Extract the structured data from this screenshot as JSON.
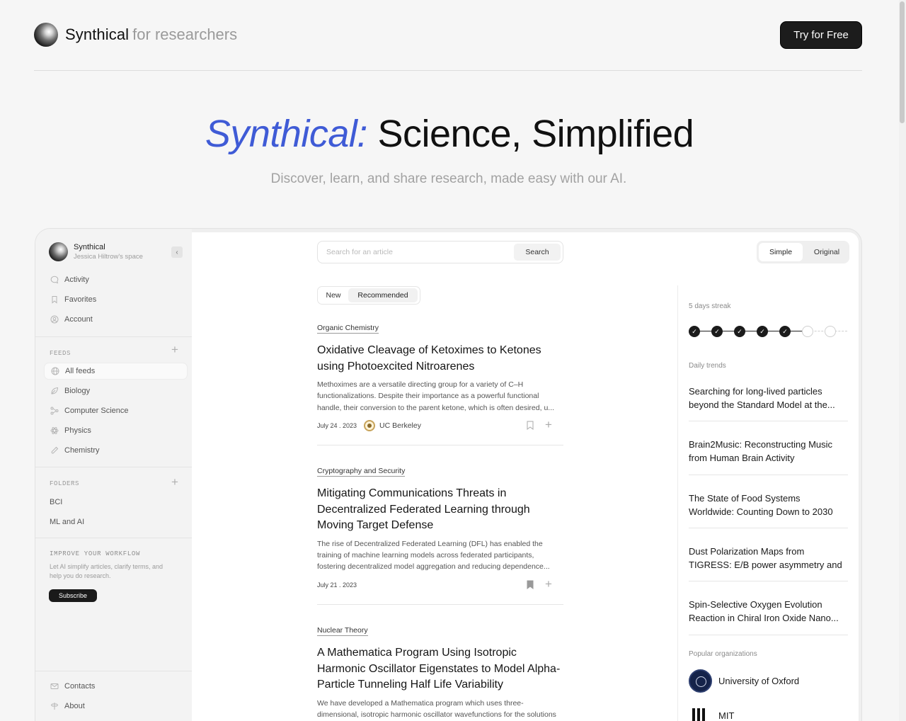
{
  "header": {
    "logo_name": "Synthical",
    "logo_tagline": "for researchers",
    "cta_label": "Try for Free"
  },
  "hero": {
    "title_accent": "Synthical:",
    "title_rest": "Science, Simplified",
    "subtitle": "Discover, learn, and share research, made easy with our AI."
  },
  "sidebar": {
    "workspace_name": "Synthical",
    "workspace_owner": "Jessica Hiltrow's space",
    "collapse_icon": "‹",
    "nav": [
      {
        "label": "Activity",
        "icon": "chat-icon"
      },
      {
        "label": "Favorites",
        "icon": "bookmark-icon"
      },
      {
        "label": "Account",
        "icon": "user-icon"
      }
    ],
    "feeds_label": "FEEDS",
    "feeds": [
      {
        "label": "All feeds",
        "icon": "globe-icon"
      },
      {
        "label": "Biology",
        "icon": "leaf-icon"
      },
      {
        "label": "Computer Science",
        "icon": "nodes-icon"
      },
      {
        "label": "Physics",
        "icon": "atom-icon"
      },
      {
        "label": "Chemistry",
        "icon": "flask-icon"
      }
    ],
    "folders_label": "FOLDERS",
    "folders": [
      "BCI",
      "ML and AI"
    ],
    "promo_title": "IMPROVE YOUR WORKFLOW",
    "promo_text": "Let AI simplify articles, clarify terms, and help you do research.",
    "subscribe_label": "Subscribe",
    "footer": [
      {
        "label": "Contacts",
        "icon": "mail-icon"
      },
      {
        "label": "About",
        "icon": "signpost-icon"
      }
    ]
  },
  "search": {
    "placeholder": "Search for an article",
    "button_label": "Search"
  },
  "mode_toggle": {
    "simple": "Simple",
    "original": "Original"
  },
  "feed_tabs": {
    "new": "New",
    "recommended": "Recommended"
  },
  "articles": [
    {
      "category": "Organic Chemistry",
      "title": "Oxidative Cleavage of Ketoximes to Ketones using Photoexcited Nitroarenes",
      "abstract": "Methoximes are a versatile directing group for a variety of C–H functionalizations. Despite their importance as a powerful functional handle, their conversion to the parent ketone, which is often desired, u...",
      "date": "July 24 . 2023",
      "org": "UC Berkeley"
    },
    {
      "category": "Cryptography and Security",
      "title": "Mitigating Communications Threats in Decentralized Federated Learning through Moving Target Defense",
      "abstract": "The rise of Decentralized Federated Learning (DFL) has enabled the training of machine learning models across federated participants, fostering decentralized model aggregation and reducing dependence...",
      "date": "July 21 . 2023",
      "org": ""
    },
    {
      "category": "Nuclear Theory",
      "title": "A Mathematica Program Using Isotropic Harmonic Oscillator Eigenstates to Model Alpha-Particle Tunneling Half Life Variability",
      "abstract": "We have developed a Mathematica program which uses three-dimensional, isotropic harmonic oscillator wavefunctions for the solutions interior to the nucleus, and Coulomb wavefunctions...",
      "date": "",
      "org": ""
    }
  ],
  "right": {
    "streak_label": "5 days streak",
    "streak_days_done": 5,
    "streak_days_total": 7,
    "check_glyph": "✓",
    "trends_label": "Daily trends",
    "trends": [
      "Searching for long-lived particles beyond the Standard Model at the...",
      "Brain2Music: Reconstructing Music from Human Brain Activity",
      "The State of Food Systems Worldwide: Counting Down to 2030",
      "Dust Polarization Maps from TIGRESS: E/B power asymmetry and",
      "Spin-Selective Oxygen Evolution Reaction in Chiral Iron Oxide Nano..."
    ],
    "orgs_label": "Popular organizations",
    "orgs": [
      "University of Oxford",
      "MIT"
    ]
  },
  "colors": {
    "accent": "#3f5bd6",
    "primary_button": "#1c1c1c"
  }
}
